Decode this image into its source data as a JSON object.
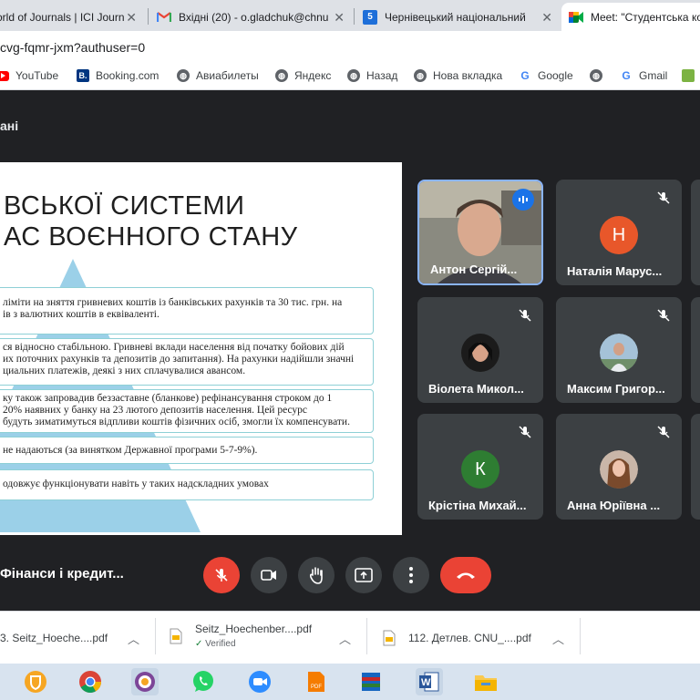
{
  "browser": {
    "tabs": [
      {
        "title": "orld of Journals | ICI Journ",
        "icon": "journals-favicon"
      },
      {
        "title": "Вхідні (20) - o.gladchuk@chnu",
        "icon": "gmail-icon"
      },
      {
        "title": "Чернівецький національний",
        "icon": "site-favicon",
        "badge": "5"
      },
      {
        "title": "Meet: \"Студентська ко",
        "icon": "meet-icon"
      }
    ],
    "close_glyph": "✕",
    "url": "cvg-fqmr-jxm?authuser=0",
    "bookmarks": [
      {
        "label": "YouTube",
        "icon": "youtube-icon"
      },
      {
        "label": "Booking.com",
        "icon": "booking-icon",
        "badge": "B."
      },
      {
        "label": "Авиабилеты",
        "icon": "globe-icon"
      },
      {
        "label": "Яндекс",
        "icon": "globe-icon"
      },
      {
        "label": "Назад",
        "icon": "globe-icon"
      },
      {
        "label": "Нова вкладка",
        "icon": "globe-icon"
      },
      {
        "label": "Google",
        "icon": "google-icon",
        "badge": "G"
      },
      {
        "label": "",
        "icon": "globe-icon"
      },
      {
        "label": "Gmail",
        "icon": "google-icon",
        "badge": "G"
      }
    ]
  },
  "meet": {
    "header_title": "ані",
    "slide": {
      "title_line1": "ВСЬКОЇ СИСТЕМИ",
      "title_line2": "АС ВОЄННОГО СТАНУ",
      "bullets": [
        {
          "line1": "ліміти на зняття гривневих коштів із банківських рахунків та 30 тис. грн. на",
          "line2": "ів з валютних коштів в еквіваленті."
        },
        {
          "line1": "ся відносно стабільною. Гривневі вклади населення від початку бойових дій",
          "line2": "их поточних рахунків та депозитів до запитання). На рахунки надійшли значні",
          "line3": "циальних платежів, деякі з них сплачувалися авансом."
        },
        {
          "line1": "ку також запровадив беззаставне (бланкове) рефінансування строком до 1",
          "line2": "20% наявних у банку на 23 лютого депозитів населення. Цей ресурс",
          "line3": "будуть зиматимуться відпливи коштів фізичних осіб, змогли їх компенсувати."
        },
        {
          "line1": "не надаються (за винятком Державної програми 5-7-9%)."
        },
        {
          "line1": "одовжує функціонувати навіть у таких надскладних умовах"
        }
      ]
    },
    "participants": [
      {
        "name": "Антон Сергій...",
        "type": "video",
        "speaking": true
      },
      {
        "name": "Наталія Марус...",
        "initial": "Н",
        "color": "#e8572a",
        "muted": true
      },
      {
        "name": "Віолета Микол...",
        "type": "photo",
        "muted": true
      },
      {
        "name": "Максим Григор...",
        "type": "photo",
        "muted": true
      },
      {
        "name": "Крістіна Михай...",
        "initial": "К",
        "color": "#2e7d32",
        "muted": true
      },
      {
        "name": "Анна Юріївна ...",
        "type": "photo",
        "muted": true
      }
    ],
    "meeting_name": "Фінанси і кредит...",
    "controls": [
      {
        "name": "mic-off",
        "color": "#ea4335"
      },
      {
        "name": "camera"
      },
      {
        "name": "raise-hand"
      },
      {
        "name": "present"
      },
      {
        "name": "more-options"
      },
      {
        "name": "leave-call",
        "color": "#ea4335"
      }
    ]
  },
  "downloads": [
    {
      "filename": "3. Seitz_Hoeche....pdf",
      "status": ""
    },
    {
      "filename": "Seitz_Hoechenber....pdf",
      "status": "Verified"
    },
    {
      "filename": "112. Детлев. CNU_....pdf",
      "status": ""
    }
  ],
  "taskbar": [
    {
      "icon": "bitwarden-icon"
    },
    {
      "icon": "chrome-icon"
    },
    {
      "icon": "tor-icon"
    },
    {
      "icon": "whatsapp-icon"
    },
    {
      "icon": "zoom-icon"
    },
    {
      "icon": "pdf-reader-icon"
    },
    {
      "icon": "winrar-icon"
    },
    {
      "icon": "word-icon",
      "label": "W"
    },
    {
      "icon": "explorer-icon"
    }
  ]
}
